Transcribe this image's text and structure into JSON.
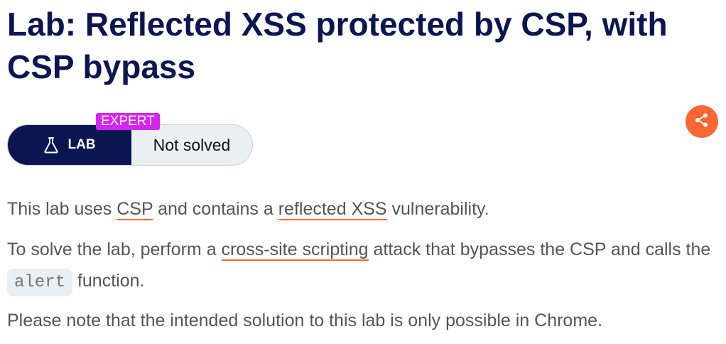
{
  "title": "Lab: Reflected XSS protected by CSP, with CSP bypass",
  "badge": {
    "level": "EXPERT",
    "lab_label": "LAB",
    "status": "Not solved"
  },
  "colors": {
    "heading": "#0b1651",
    "expert_badge": "#d426ef",
    "share_button": "#ff6633",
    "link_underline": "#ff6633",
    "status_bg": "#eaeff2"
  },
  "icons": {
    "lab": "flask-icon",
    "share": "share-icon"
  },
  "intro": {
    "t1": "This lab uses ",
    "link_csp": "CSP",
    "t2": " and contains a ",
    "link_reflected": "reflected XSS",
    "t3": " vulnerability."
  },
  "task": {
    "t1": "To solve the lab, perform a ",
    "link_xss": "cross-site scripting",
    "t2": " attack that bypasses the CSP and calls the ",
    "code": "alert",
    "t3": " function."
  },
  "note": "Please note that the intended solution to this lab is only possible in Chrome."
}
